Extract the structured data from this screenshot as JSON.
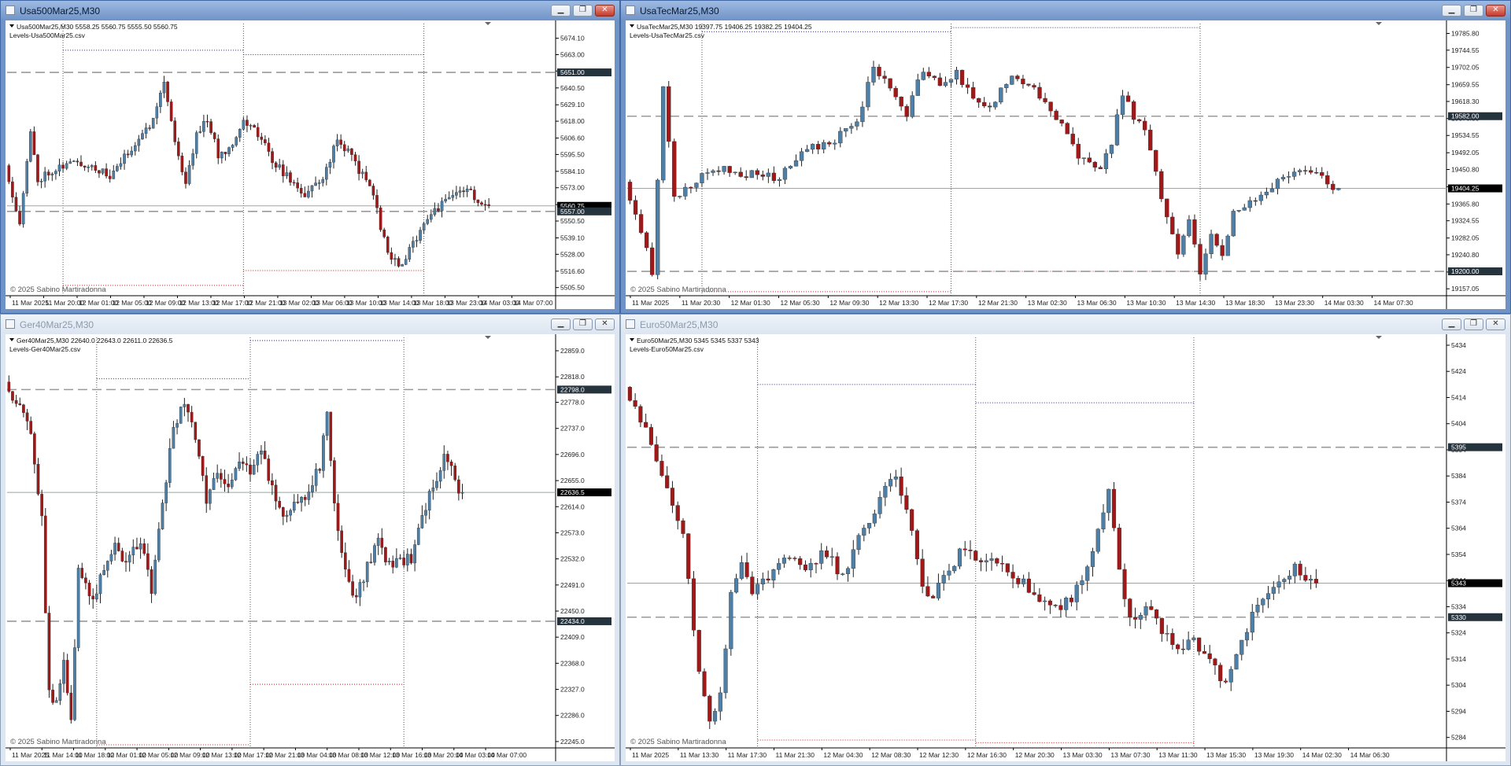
{
  "colors": {
    "bull": "#4e7fa6",
    "bear": "#a11818",
    "level": "#9a9a9a",
    "blueDot": "#2a2a8a",
    "redDot": "#c02020",
    "tagDark": "#25333d",
    "tagBlack": "#000000"
  },
  "copyright": "© 2025 Sabino Martiradonna",
  "window_buttons": [
    "minimize-button",
    "restore-button",
    "close-button"
  ],
  "chart_data": [
    {
      "type": "candlestick",
      "window_title": "Usa500Mar25,M30",
      "symbol_line": "Usa500Mar25,M30  5558.25 5560.75 5555.50 5560.75",
      "levels_file": "Levels-Usa500Mar25.csv",
      "ylim": [
        5500,
        5684
      ],
      "y_ticks": [
        "5674.10",
        "5663.00",
        "5651.90",
        "5640.50",
        "5629.10",
        "5618.00",
        "5606.60",
        "5595.50",
        "5584.10",
        "5573.00",
        "5561.60",
        "5550.50",
        "5539.10",
        "5528.00",
        "5516.60",
        "5505.50"
      ],
      "x_ticks": [
        "11 Mar 2025",
        "11 Mar 20:00",
        "12 Mar 01:00",
        "12 Mar 05:00",
        "12 Mar 09:00",
        "12 Mar 13:00",
        "12 Mar 17:00",
        "12 Mar 21:00",
        "13 Mar 02:00",
        "13 Mar 06:00",
        "13 Mar 10:00",
        "13 Mar 14:00",
        "13 Mar 18:00",
        "13 Mar 23:00",
        "14 Mar 03:00",
        "14 Mar 07:00"
      ],
      "bars": 140,
      "anchors": [
        [
          0,
          5588
        ],
        [
          4,
          5550
        ],
        [
          7,
          5610
        ],
        [
          9,
          5578
        ],
        [
          12,
          5584
        ],
        [
          18,
          5590
        ],
        [
          24,
          5588
        ],
        [
          29,
          5580
        ],
        [
          35,
          5600
        ],
        [
          40,
          5615
        ],
        [
          44,
          5645
        ],
        [
          47,
          5605
        ],
        [
          50,
          5575
        ],
        [
          53,
          5610
        ],
        [
          56,
          5620
        ],
        [
          59,
          5595
        ],
        [
          62,
          5600
        ],
        [
          66,
          5618
        ],
        [
          70,
          5610
        ],
        [
          74,
          5592
        ],
        [
          79,
          5578
        ],
        [
          83,
          5568
        ],
        [
          88,
          5580
        ],
        [
          92,
          5605
        ],
        [
          95,
          5598
        ],
        [
          98,
          5585
        ],
        [
          102,
          5570
        ],
        [
          104,
          5545
        ],
        [
          107,
          5525
        ],
        [
          110,
          5520
        ],
        [
          113,
          5535
        ],
        [
          116,
          5550
        ],
        [
          119,
          5558
        ],
        [
          123,
          5565
        ],
        [
          126,
          5572
        ],
        [
          129,
          5570
        ],
        [
          132,
          5560
        ],
        [
          133,
          5561
        ]
      ],
      "seed": 11,
      "current_price": 5560.75,
      "price_tags": [
        {
          "label": "5651.00",
          "price": 5651.0,
          "style": "dark"
        },
        {
          "label": "5560.75",
          "price": 5560.75,
          "style": "black"
        },
        {
          "label": "5557.00",
          "price": 5557.0,
          "style": "dark"
        }
      ],
      "dashed_levels": [
        5651.0,
        5557.0
      ],
      "vlines": [
        15,
        65,
        115
      ],
      "dotted_upper": [
        [
          15,
          65,
          5666
        ],
        [
          65,
          115,
          5663
        ]
      ],
      "dotted_lower": [
        [
          15,
          65,
          5507
        ],
        [
          65,
          115,
          5517
        ]
      ]
    },
    {
      "type": "candlestick",
      "window_title": "UsaTecMar25,M30",
      "symbol_line": "UsaTecMar25,M30  19397.75 19406.25 19382.25 19404.25",
      "levels_file": "Levels-UsaTecMar25.csv",
      "ylim": [
        19140,
        19810
      ],
      "y_ticks": [
        "19785.80",
        "19744.55",
        "19702.05",
        "19659.55",
        "19618.30",
        "19576.30",
        "19534.55",
        "19492.05",
        "19450.80",
        "19408.30",
        "19365.80",
        "19324.55",
        "19282.05",
        "19240.80",
        "19198.30",
        "19157.05"
      ],
      "x_ticks": [
        "11 Mar 2025",
        "11 Mar 20:30",
        "12 Mar 01:30",
        "12 Mar 05:30",
        "12 Mar 09:30",
        "12 Mar 13:30",
        "12 Mar 17:30",
        "12 Mar 21:30",
        "13 Mar 02:30",
        "13 Mar 06:30",
        "13 Mar 10:30",
        "13 Mar 14:30",
        "13 Mar 18:30",
        "13 Mar 23:30",
        "14 Mar 03:30",
        "14 Mar 07:30"
      ],
      "bars": 136,
      "anchors": [
        [
          0,
          19420
        ],
        [
          3,
          19300
        ],
        [
          5,
          19200
        ],
        [
          7,
          19660
        ],
        [
          9,
          19380
        ],
        [
          12,
          19410
        ],
        [
          16,
          19455
        ],
        [
          22,
          19440
        ],
        [
          28,
          19430
        ],
        [
          33,
          19500
        ],
        [
          38,
          19525
        ],
        [
          42,
          19570
        ],
        [
          45,
          19700
        ],
        [
          48,
          19650
        ],
        [
          51,
          19590
        ],
        [
          54,
          19700
        ],
        [
          57,
          19650
        ],
        [
          60,
          19690
        ],
        [
          63,
          19620
        ],
        [
          66,
          19600
        ],
        [
          70,
          19690
        ],
        [
          74,
          19650
        ],
        [
          78,
          19580
        ],
        [
          82,
          19480
        ],
        [
          86,
          19450
        ],
        [
          88,
          19520
        ],
        [
          90,
          19640
        ],
        [
          92,
          19580
        ],
        [
          94,
          19550
        ],
        [
          96,
          19440
        ],
        [
          98,
          19330
        ],
        [
          100,
          19250
        ],
        [
          102,
          19320
        ],
        [
          104,
          19200
        ],
        [
          106,
          19300
        ],
        [
          108,
          19230
        ],
        [
          110,
          19340
        ],
        [
          113,
          19375
        ],
        [
          116,
          19400
        ],
        [
          119,
          19430
        ],
        [
          122,
          19450
        ],
        [
          125,
          19440
        ],
        [
          128,
          19410
        ]
      ],
      "seed": 23,
      "current_price": 19404.25,
      "price_tags": [
        {
          "label": "19582.00",
          "price": 19582.0,
          "style": "dark"
        },
        {
          "label": "19404.25",
          "price": 19404.25,
          "style": "black"
        },
        {
          "label": "19200.00",
          "price": 19200.0,
          "style": "dark"
        }
      ],
      "dashed_levels": [
        19582.0,
        19200.0
      ],
      "vlines": [
        13,
        58,
        103
      ],
      "dotted_upper": [
        [
          13,
          58,
          19790
        ],
        [
          58,
          103,
          19800
        ]
      ],
      "dotted_lower": [
        [
          13,
          58,
          19150
        ],
        [
          58,
          103,
          19200
        ]
      ]
    },
    {
      "type": "candlestick",
      "window_title": "Ger40Mar25,M30",
      "symbol_line": "Ger40Mar25,M30  22640.0 22643.0 22611.0 22636.5",
      "levels_file": "Levels-Ger40Mar25.csv",
      "ylim": [
        22235,
        22880
      ],
      "y_ticks": [
        "22859.0",
        "22818.0",
        "22778.0",
        "22737.0",
        "22696.0",
        "22655.0",
        "22614.0",
        "22573.0",
        "22532.0",
        "22491.0",
        "22450.0",
        "22409.0",
        "22368.0",
        "22327.0",
        "22286.0",
        "22245.0"
      ],
      "x_ticks": [
        "11 Mar 2025",
        "11 Mar 14:00",
        "11 Mar 18:00",
        "12 Mar 01:00",
        "12 Mar 05:00",
        "12 Mar 09:00",
        "12 Mar 13:00",
        "12 Mar 17:00",
        "12 Mar 21:00",
        "13 Mar 04:00",
        "13 Mar 08:00",
        "13 Mar 12:00",
        "13 Mar 16:00",
        "13 Mar 20:00",
        "14 Mar 03:00",
        "14 Mar 07:00"
      ],
      "bars": 138,
      "anchors": [
        [
          0,
          22810
        ],
        [
          4,
          22770
        ],
        [
          7,
          22730
        ],
        [
          10,
          22590
        ],
        [
          12,
          22320
        ],
        [
          14,
          22300
        ],
        [
          16,
          22380
        ],
        [
          18,
          22270
        ],
        [
          20,
          22520
        ],
        [
          22,
          22500
        ],
        [
          24,
          22460
        ],
        [
          27,
          22520
        ],
        [
          30,
          22550
        ],
        [
          33,
          22530
        ],
        [
          37,
          22560
        ],
        [
          40,
          22480
        ],
        [
          43,
          22620
        ],
        [
          46,
          22740
        ],
        [
          49,
          22780
        ],
        [
          52,
          22720
        ],
        [
          55,
          22620
        ],
        [
          58,
          22670
        ],
        [
          61,
          22650
        ],
        [
          64,
          22690
        ],
        [
          67,
          22670
        ],
        [
          70,
          22700
        ],
        [
          73,
          22640
        ],
        [
          76,
          22600
        ],
        [
          80,
          22620
        ],
        [
          83,
          22640
        ],
        [
          86,
          22680
        ],
        [
          88,
          22760
        ],
        [
          90,
          22620
        ],
        [
          93,
          22510
        ],
        [
          96,
          22470
        ],
        [
          99,
          22520
        ],
        [
          102,
          22560
        ],
        [
          105,
          22520
        ],
        [
          108,
          22530
        ],
        [
          111,
          22530
        ],
        [
          114,
          22600
        ],
        [
          117,
          22650
        ],
        [
          120,
          22690
        ],
        [
          122,
          22680
        ],
        [
          124,
          22630
        ]
      ],
      "seed": 37,
      "current_price": 22636.5,
      "price_tags": [
        {
          "label": "22798.0",
          "price": 22798.0,
          "style": "dark"
        },
        {
          "label": "22636.5",
          "price": 22636.5,
          "style": "black"
        },
        {
          "label": "22434.0",
          "price": 22434.0,
          "style": "dark"
        }
      ],
      "dashed_levels": [
        22798.0,
        22434.0
      ],
      "vlines": [
        24,
        66,
        108
      ],
      "dotted_upper": [
        [
          24,
          66,
          22815
        ],
        [
          66,
          108,
          22875
        ]
      ],
      "dotted_lower": [
        [
          24,
          66,
          22240
        ],
        [
          66,
          108,
          22335
        ]
      ]
    },
    {
      "type": "candlestick",
      "window_title": "Euro50Mar25,M30",
      "symbol_line": "Euro50Mar25,M30  5345 5345 5337 5343",
      "levels_file": "Levels-Euro50Mar25.csv",
      "ylim": [
        5280,
        5437
      ],
      "y_ticks": [
        "5434",
        "5424",
        "5414",
        "5404",
        "5394",
        "5384",
        "5374",
        "5364",
        "5354",
        "5344",
        "5334",
        "5324",
        "5314",
        "5304",
        "5294",
        "5284"
      ],
      "x_ticks": [
        "11 Mar 2025",
        "11 Mar 13:30",
        "11 Mar 17:30",
        "11 Mar 21:30",
        "12 Mar 04:30",
        "12 Mar 08:30",
        "12 Mar 12:30",
        "12 Mar 16:30",
        "12 Mar 20:30",
        "13 Mar 03:30",
        "13 Mar 07:30",
        "13 Mar 11:30",
        "13 Mar 15:30",
        "13 Mar 19:30",
        "14 Mar 02:30",
        "14 Mar 06:30"
      ],
      "bars": 142,
      "anchors": [
        [
          0,
          5418
        ],
        [
          4,
          5402
        ],
        [
          8,
          5380
        ],
        [
          11,
          5362
        ],
        [
          14,
          5310
        ],
        [
          16,
          5292
        ],
        [
          18,
          5300
        ],
        [
          20,
          5340
        ],
        [
          22,
          5350
        ],
        [
          24,
          5338
        ],
        [
          27,
          5345
        ],
        [
          30,
          5352
        ],
        [
          34,
          5350
        ],
        [
          38,
          5355
        ],
        [
          41,
          5345
        ],
        [
          44,
          5360
        ],
        [
          47,
          5368
        ],
        [
          49,
          5380
        ],
        [
          51,
          5385
        ],
        [
          53,
          5372
        ],
        [
          55,
          5350
        ],
        [
          57,
          5336
        ],
        [
          60,
          5345
        ],
        [
          63,
          5355
        ],
        [
          66,
          5352
        ],
        [
          70,
          5350
        ],
        [
          74,
          5345
        ],
        [
          78,
          5335
        ],
        [
          82,
          5334
        ],
        [
          86,
          5342
        ],
        [
          89,
          5365
        ],
        [
          91,
          5378
        ],
        [
          93,
          5348
        ],
        [
          95,
          5328
        ],
        [
          98,
          5335
        ],
        [
          101,
          5325
        ],
        [
          104,
          5318
        ],
        [
          107,
          5322
        ],
        [
          110,
          5312
        ],
        [
          113,
          5305
        ],
        [
          116,
          5320
        ],
        [
          119,
          5335
        ],
        [
          122,
          5340
        ],
        [
          125,
          5348
        ],
        [
          127,
          5348
        ],
        [
          129,
          5343
        ]
      ],
      "seed": 53,
      "current_price": 5343,
      "price_tags": [
        {
          "label": "5395",
          "price": 5395,
          "style": "dark"
        },
        {
          "label": "5343",
          "price": 5343,
          "style": "black"
        },
        {
          "label": "5330",
          "price": 5330,
          "style": "dark"
        }
      ],
      "dashed_levels": [
        5395,
        5330
      ],
      "vlines": [
        24,
        65,
        106
      ],
      "dotted_upper": [
        [
          24,
          65,
          5419
        ],
        [
          65,
          106,
          5412
        ]
      ],
      "dotted_lower": [
        [
          24,
          65,
          5283
        ],
        [
          65,
          106,
          5282
        ]
      ]
    }
  ]
}
